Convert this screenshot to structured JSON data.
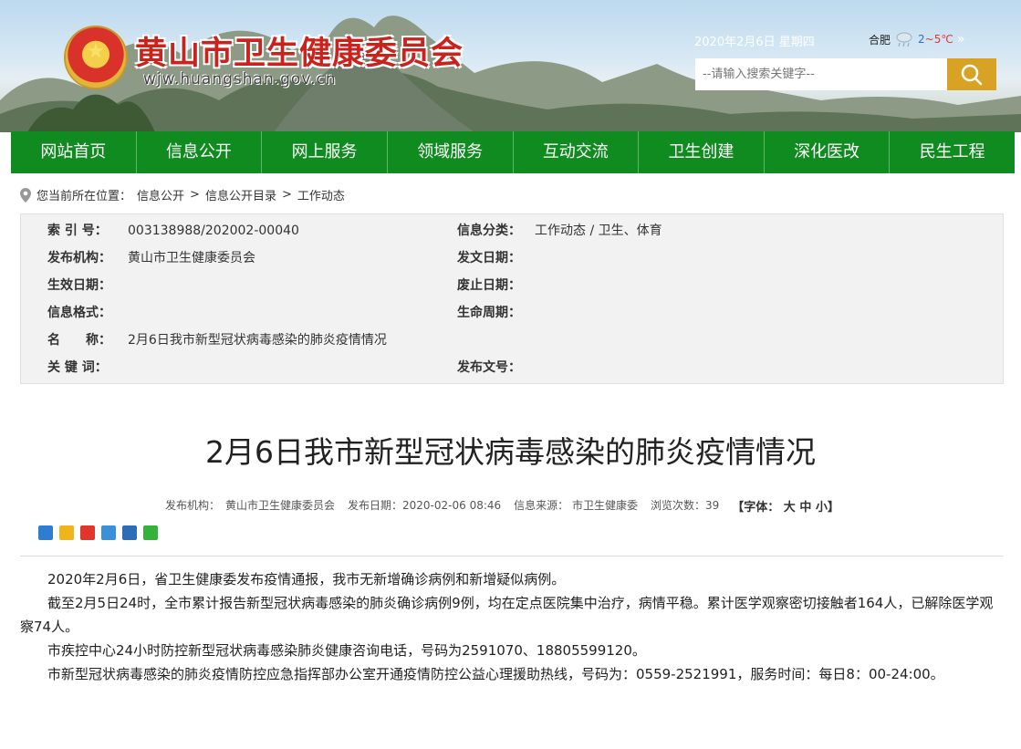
{
  "header": {
    "site_title": "黄山市卫生健康委员会",
    "site_url": "wjw.huangshan.gov.cn",
    "date": "2020年2月6日 星期四",
    "weather": {
      "city": "合肥",
      "temp_low": "2",
      "temp_high": "~5℃",
      "more": "»",
      "icon": "cloud-rain-icon"
    },
    "search_placeholder": "--请输入搜索关键字--",
    "search_icon": "search-icon"
  },
  "nav": [
    "网站首页",
    "信息公开",
    "网上服务",
    "领域服务",
    "互动交流",
    "卫生创建",
    "深化医改",
    "民生工程"
  ],
  "breadcrumb": {
    "prefix": "您当前所在位置：",
    "items": [
      "信息公开",
      "信息公开目录",
      "工作动态"
    ],
    "sep": ">"
  },
  "meta": {
    "index_label": "索 引 号：",
    "index_value": "003138988/202002-00040",
    "category_label": "信息分类：",
    "category_value": "工作动态 / 卫生、体育",
    "publisher_label": "发布机构：",
    "publisher_value": "黄山市卫生健康委员会",
    "issue_date_label": "发文日期：",
    "issue_date_value": "",
    "effective_label": "生效日期：",
    "effective_value": "",
    "repeal_label": "废止日期：",
    "repeal_value": "",
    "format_label": "信息格式：",
    "format_value": "",
    "lifecycle_label": "生命周期：",
    "lifecycle_value": "",
    "name_label": "名　　称：",
    "name_value": "2月6日我市新型冠状病毒感染的肺炎疫情情况",
    "keywords_label": "关 键 词：",
    "keywords_value": "",
    "doc_no_label": "发布文号：",
    "doc_no_value": ""
  },
  "article": {
    "title": "2月6日我市新型冠状病毒感染的肺炎疫情情况",
    "info": {
      "publisher": "发布机构：　黄山市卫生健康委员会",
      "date": "发布日期：2020-02-06 08:46",
      "source": "信息来源：  市卫生健康委",
      "views": "浏览次数：39",
      "fontsize": "【字体： 大 中 小】"
    },
    "share_icons": [
      "qzone-icon",
      "tqq-icon",
      "weibo-icon",
      "pengyou-icon",
      "renren-icon",
      "wechat-icon"
    ],
    "paragraphs": [
      "2020年2月6日，省卫生健康委发布疫情通报，我市无新增确诊病例和新增疑似病例。",
      "截至2月5日24时，全市累计报告新型冠状病毒感染的肺炎确诊病例9例，均在定点医院集中治疗，病情平稳。累计医学观察密切接触者164人，已解除医学观察74人。",
      "市疾控中心24小时防控新型冠状病毒感染肺炎健康咨询电话，号码为2591070、18805599120。",
      "市新型冠状病毒感染的肺炎疫情防控应急指挥部办公室开通疫情防控公益心理援助热线，号码为：0559-2521991，服务时间：每日8：00-24:00。"
    ]
  },
  "colors": {
    "nav_green": "#0f8b1f",
    "title_red": "#c8231c",
    "search_gold": "#d8a325"
  }
}
